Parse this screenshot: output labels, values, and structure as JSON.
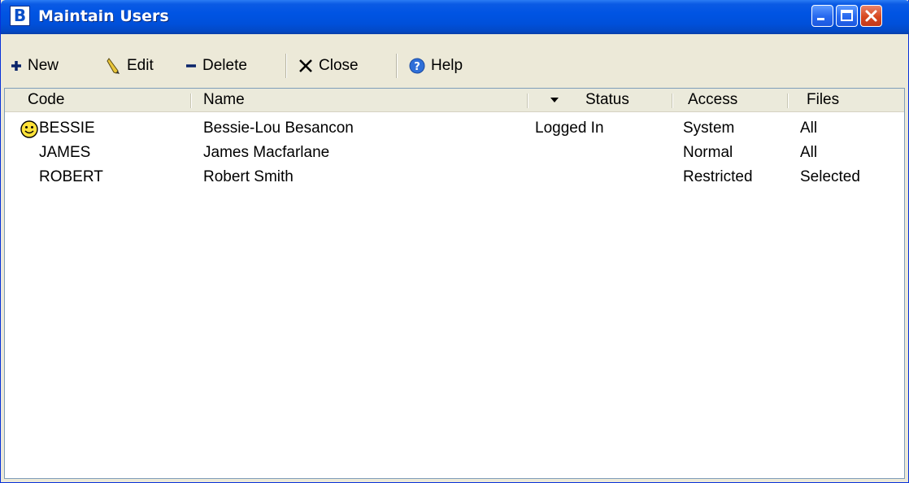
{
  "window": {
    "title": "Maintain Users",
    "logo_letter": "B"
  },
  "toolbar": {
    "new_label": "New",
    "edit_label": "Edit",
    "delete_label": "Delete",
    "close_label": "Close",
    "help_label": "Help"
  },
  "table": {
    "columns": {
      "code": "Code",
      "name": "Name",
      "status": "Status",
      "access": "Access",
      "files": "Files"
    },
    "rows": [
      {
        "code": "BESSIE",
        "name": "Bessie-Lou Besancon",
        "status": "Logged In",
        "access": "System",
        "files": "All",
        "icon": "smiley-icon"
      },
      {
        "code": "JAMES",
        "name": "James Macfarlane",
        "status": "",
        "access": "Normal",
        "files": "All"
      },
      {
        "code": "ROBERT",
        "name": "Robert Smith",
        "status": "",
        "access": "Restricted",
        "files": "Selected"
      }
    ]
  },
  "colors": {
    "titlebar": "#0054e3",
    "chrome": "#ece9d8",
    "close": "#d7481f"
  }
}
